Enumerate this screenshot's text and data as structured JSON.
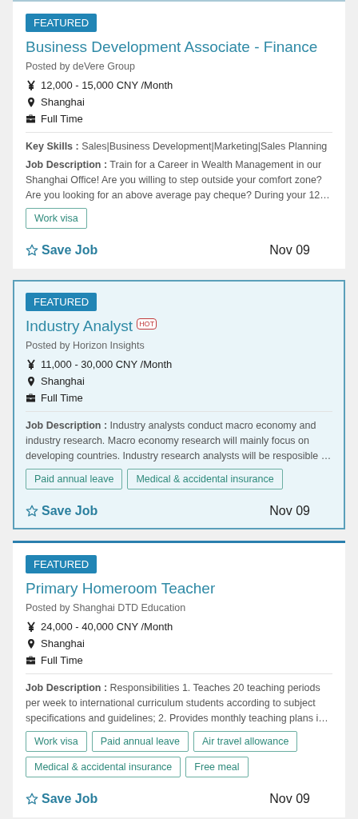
{
  "jobs": [
    {
      "badge": "FEATURED",
      "title": "Business Development Associate - Finance",
      "selected": false,
      "posted_by": "Posted by deVere Group",
      "salary": "12,000 - 15,000 CNY /Month",
      "location": "Shanghai",
      "job_type": "Full Time",
      "key_skills": "**Key Skills :** Sales|Business Development|Marketing|Sales Planning",
      "description": "**Job Description :** Train for a Career in Wealth Management in our Shanghai Office! Are you willing to step outside your comfort zone? Are you looking for an above average pay cheque? During your 12…",
      "tags": [
        "Work visa"
      ],
      "save_label": "Save Job",
      "date": "Nov 09"
    },
    {
      "badge": "FEATURED",
      "title": "Industry Analyst",
      "hot": "HOT",
      "selected": true,
      "posted_by": "Posted by Horizon Insights",
      "salary": "11,000 - 30,000 CNY /Month",
      "location": "Shanghai",
      "job_type": "Full Time",
      "description": "**Job Description :** Industry analysts conduct macro economy and industry research. Macro economy research will mainly focus on developing countries. Industry research analysts will be resposible …",
      "tags": [
        "Paid annual leave",
        "Medical & accidental insurance"
      ],
      "save_label": "Save Job",
      "date": "Nov 09"
    },
    {
      "badge": "FEATURED",
      "title": "Primary Homeroom Teacher",
      "selected": false,
      "posted_by": "Posted by Shanghai DTD Education",
      "salary": "24,000 - 40,000 CNY /Month",
      "location": "Shanghai",
      "job_type": "Full Time",
      "description": "**Job Description :** Responsibilities 1. Teaches 20 teaching periods per week to international curriculum students according to subject specifications and guidelines; 2. Provides monthly teaching plans i…",
      "tags": [
        "Work visa",
        "Paid annual leave",
        "Air travel allowance",
        "Medical & accidental insurance",
        "Free meal"
      ],
      "save_label": "Save Job",
      "date": "Nov 09"
    }
  ]
}
